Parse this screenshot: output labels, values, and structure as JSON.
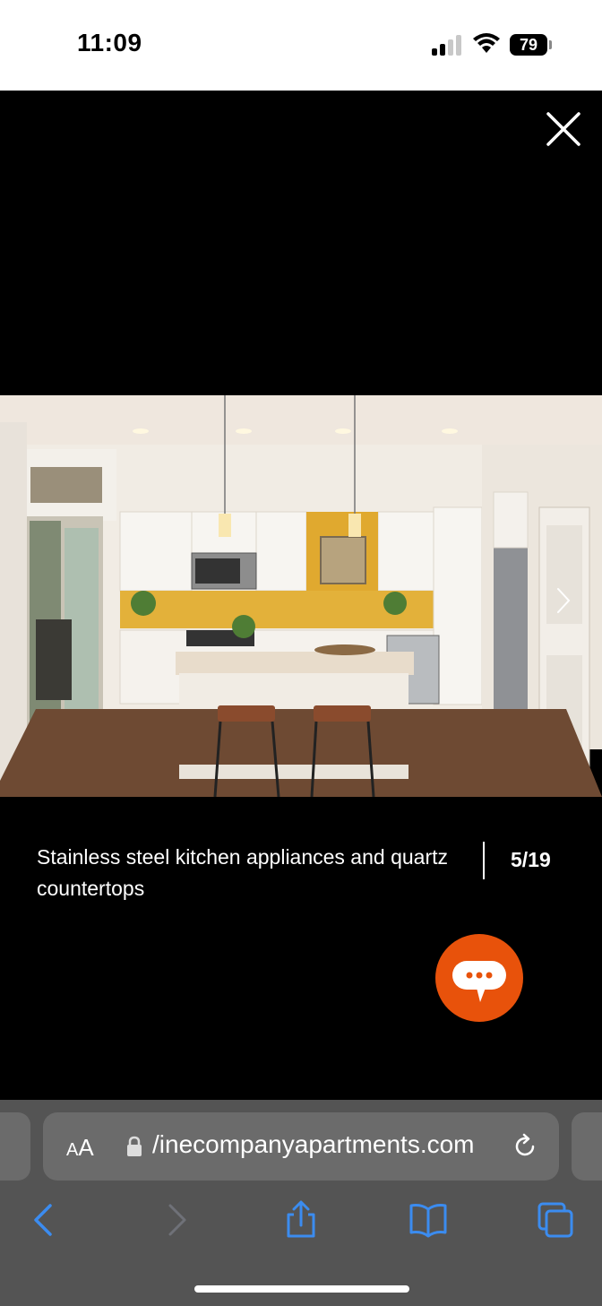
{
  "status": {
    "time": "11:09",
    "battery": "79"
  },
  "viewer": {
    "caption": "Stainless steel kitchen appliances and quartz countertops",
    "counter": "5/19",
    "chat_color": "#e8520b"
  },
  "browser": {
    "aa_label_big": "A",
    "aa_label_small": "A",
    "url": "/inecompanyapartments.com"
  },
  "icons": [
    "close-icon",
    "chevron-right-icon",
    "chat-bubble-icon",
    "lock-icon",
    "reload-icon",
    "back-icon",
    "forward-icon",
    "share-icon",
    "bookmarks-icon",
    "tabs-icon"
  ]
}
